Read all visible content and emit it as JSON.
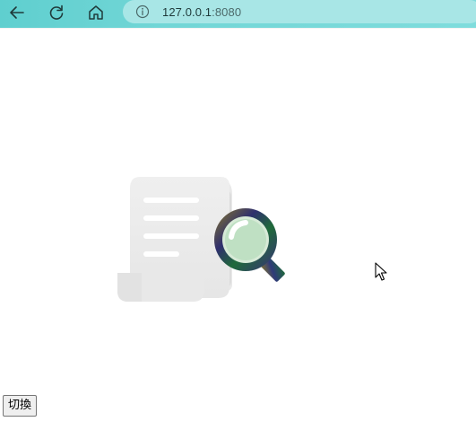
{
  "browser": {
    "url_host": "127.0.0.1",
    "url_port": ":8080",
    "toolbar_color": "#72d6d6",
    "address_bar_color": "#a8e6e6",
    "icons": [
      "back-arrow-icon",
      "reload-icon",
      "home-icon",
      "info-icon"
    ]
  },
  "main": {
    "illustration_icons": [
      "document-icon",
      "magnifier-icon"
    ],
    "switch_button_label": "切換"
  }
}
